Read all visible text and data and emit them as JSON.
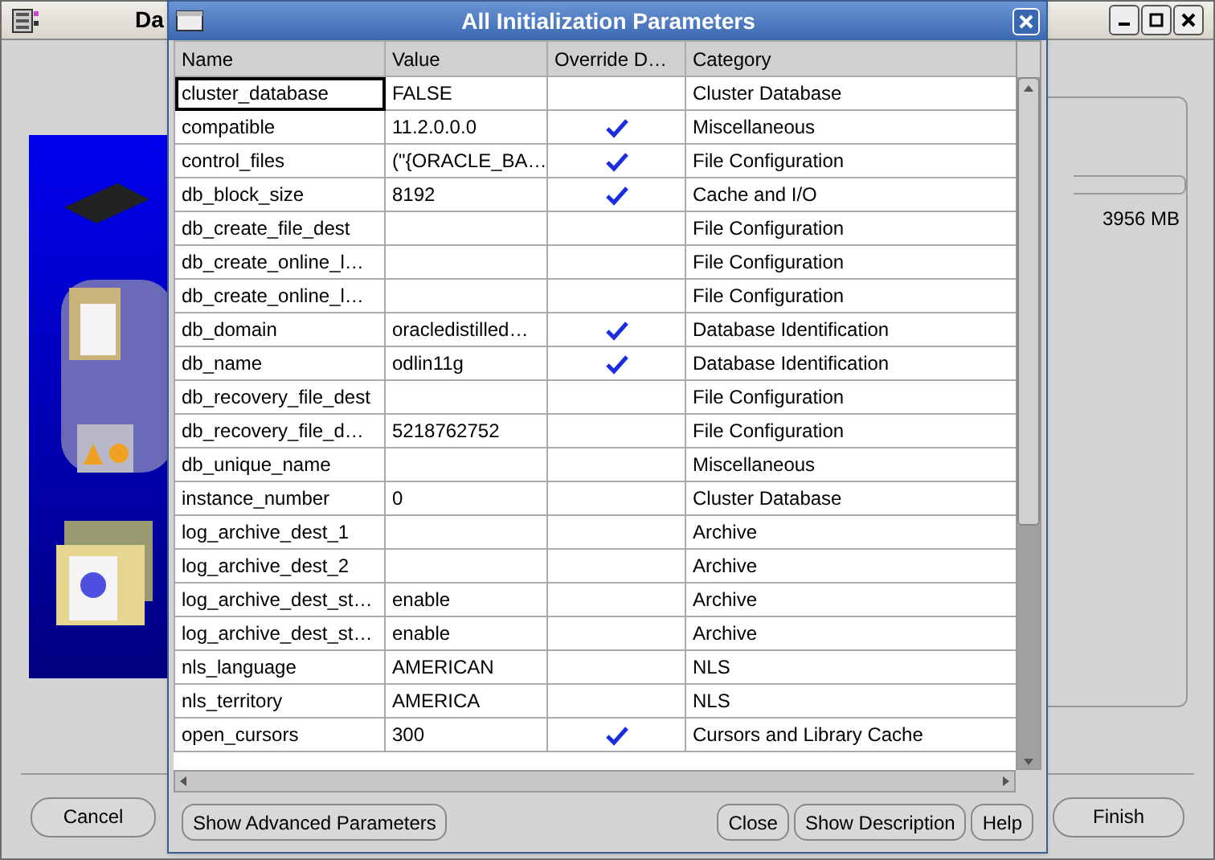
{
  "background_window": {
    "title": "Da",
    "memory_reading": "3956 MB",
    "buttons": [
      "Cancel",
      "Finish"
    ]
  },
  "dialog": {
    "title": "All Initialization Parameters",
    "table": {
      "columns": [
        "Name",
        "Value",
        "Override D…",
        "Category"
      ],
      "rows": [
        {
          "name": "cluster_database",
          "value": "FALSE",
          "override": false,
          "category": "Cluster Database",
          "selected": true
        },
        {
          "name": "compatible",
          "value": "11.2.0.0.0",
          "override": true,
          "category": "Miscellaneous",
          "selected": false
        },
        {
          "name": "control_files",
          "value": "(\"{ORACLE_BA…",
          "override": true,
          "category": "File Configuration",
          "selected": false
        },
        {
          "name": "db_block_size",
          "value": "8192",
          "override": true,
          "category": "Cache and I/O",
          "selected": false
        },
        {
          "name": "db_create_file_dest",
          "value": "",
          "override": false,
          "category": "File Configuration",
          "selected": false
        },
        {
          "name": "db_create_online_l…",
          "value": "",
          "override": false,
          "category": "File Configuration",
          "selected": false
        },
        {
          "name": "db_create_online_l…",
          "value": "",
          "override": false,
          "category": "File Configuration",
          "selected": false
        },
        {
          "name": "db_domain",
          "value": "oracledistilled…",
          "override": true,
          "category": "Database Identification",
          "selected": false
        },
        {
          "name": "db_name",
          "value": "odlin11g",
          "override": true,
          "category": "Database Identification",
          "selected": false
        },
        {
          "name": "db_recovery_file_dest",
          "value": "",
          "override": false,
          "category": "File Configuration",
          "selected": false
        },
        {
          "name": "db_recovery_file_d…",
          "value": "5218762752",
          "override": false,
          "category": "File Configuration",
          "selected": false
        },
        {
          "name": "db_unique_name",
          "value": "",
          "override": false,
          "category": "Miscellaneous",
          "selected": false
        },
        {
          "name": "instance_number",
          "value": "0",
          "override": false,
          "category": "Cluster Database",
          "selected": false
        },
        {
          "name": "log_archive_dest_1",
          "value": "",
          "override": false,
          "category": "Archive",
          "selected": false
        },
        {
          "name": "log_archive_dest_2",
          "value": "",
          "override": false,
          "category": "Archive",
          "selected": false
        },
        {
          "name": "log_archive_dest_st…",
          "value": "enable",
          "override": false,
          "category": "Archive",
          "selected": false
        },
        {
          "name": "log_archive_dest_st…",
          "value": "enable",
          "override": false,
          "category": "Archive",
          "selected": false
        },
        {
          "name": "nls_language",
          "value": "AMERICAN",
          "override": false,
          "category": "NLS",
          "selected": false
        },
        {
          "name": "nls_territory",
          "value": "AMERICA",
          "override": false,
          "category": "NLS",
          "selected": false
        },
        {
          "name": "open_cursors",
          "value": "300",
          "override": true,
          "category": "Cursors and Library Cache",
          "selected": false
        }
      ]
    },
    "left_buttons": [
      "Show Advanced Parameters"
    ],
    "right_buttons": [
      "Close",
      "Show Description",
      "Help"
    ]
  }
}
